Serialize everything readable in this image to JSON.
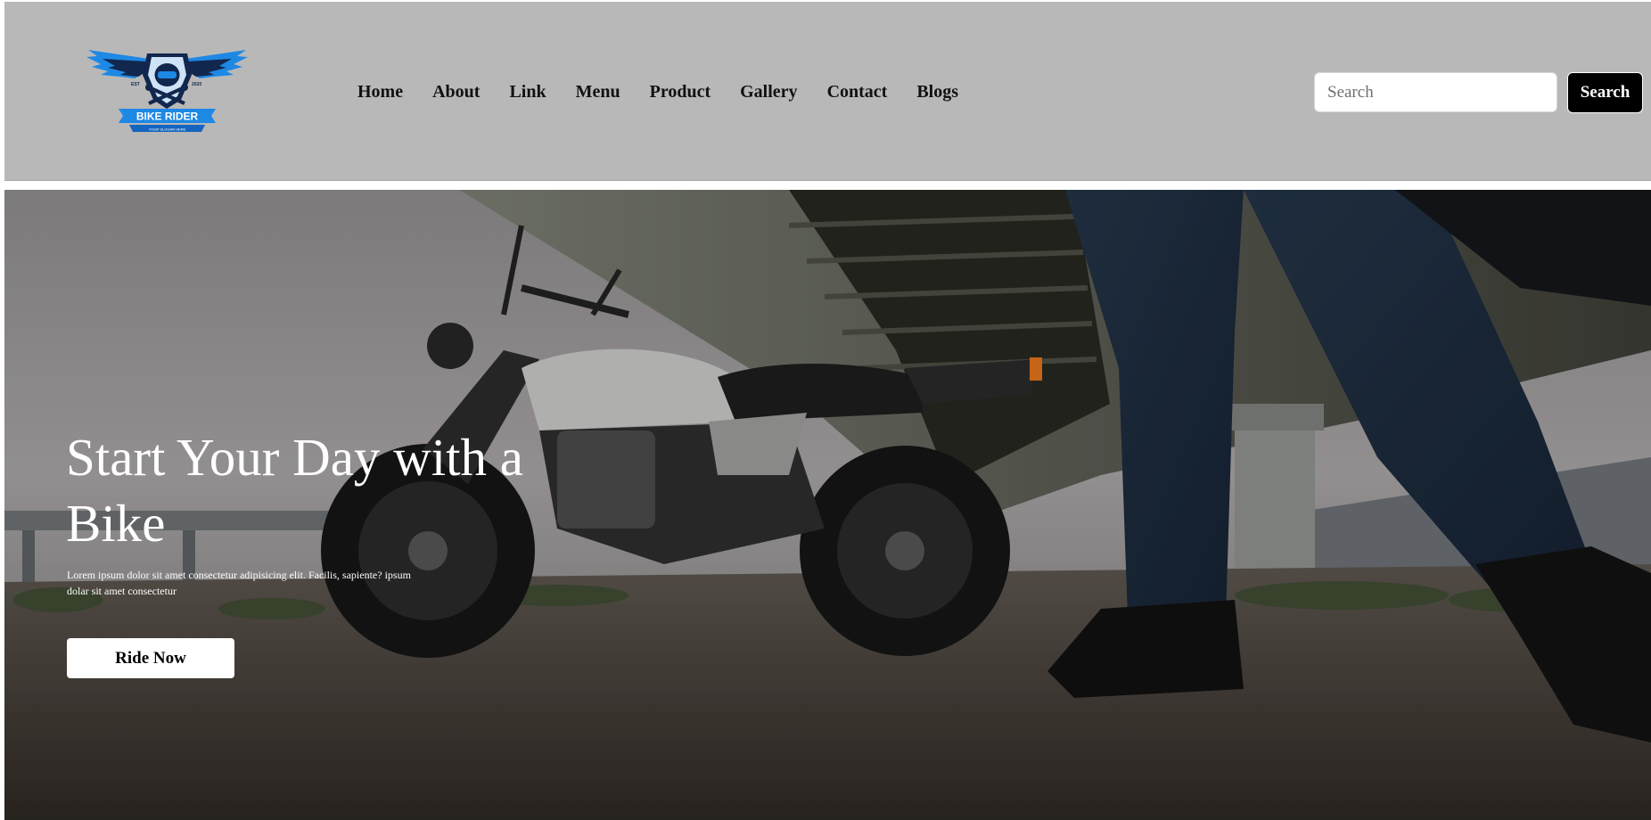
{
  "header": {
    "logo": {
      "text": "BIKE RIDER",
      "tagline": "YOUR SLOGAN HERE",
      "est_left": "EST",
      "est_right": "2020"
    },
    "nav": [
      {
        "label": "Home"
      },
      {
        "label": "About"
      },
      {
        "label": "Link"
      },
      {
        "label": "Menu"
      },
      {
        "label": "Product"
      },
      {
        "label": "Gallery"
      },
      {
        "label": "Contact"
      },
      {
        "label": "Blogs"
      }
    ],
    "search": {
      "placeholder": "Search",
      "button_label": "Search"
    }
  },
  "hero": {
    "title": "Start Your Day with a Bike",
    "text": "Lorem ipsum dolor sit amet consectetur adipisicing elit. Facilis, sapiente? ipsum dolar sit amet consectetur",
    "button_label": "Ride Now"
  },
  "colors": {
    "header_bg": "#b8b8b8",
    "search_button_bg": "#000000",
    "logo_blue": "#1e88e5",
    "logo_navy": "#12274d"
  }
}
